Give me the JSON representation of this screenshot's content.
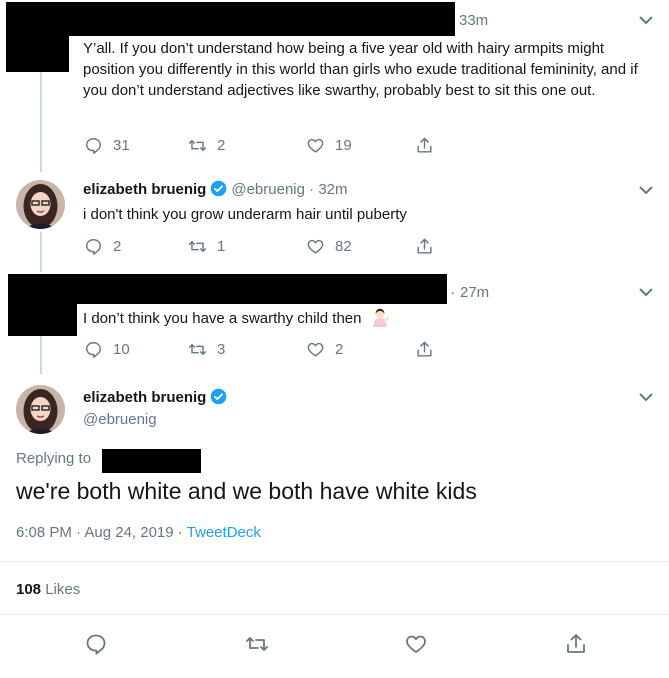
{
  "tweet1": {
    "time": "33m",
    "text": "Y’all. If you don’t understand how being a five year old with hairy armpits might position you differently in this world than girls who exude traditional femininity, and if you don’t understand adjectives like swarthy, probably best to sit this one out.",
    "replies": "31",
    "retweets": "2",
    "likes": "19"
  },
  "tweet2": {
    "name": "elizabeth bruenig",
    "handle": "@ebruenig",
    "time": "32m",
    "text": "i don't think you grow underarm hair until puberty",
    "replies": "2",
    "retweets": "1",
    "likes": "82"
  },
  "tweet3": {
    "time": "27m",
    "text": "I don’t think you have a swarthy child then",
    "emoji": "woman-tipping-hand-emoji",
    "replies": "10",
    "retweets": "3",
    "likes": "2"
  },
  "main": {
    "name": "elizabeth bruenig",
    "handle": "@ebruenig",
    "replying_to": "Replying to",
    "text": "we're both white and we both have white kids",
    "timestamp": "6:08 PM · Aug 24, 2019 · ",
    "source": "TweetDeck",
    "likes_count": "108",
    "likes_label": "Likes"
  },
  "colors": {
    "accent": "#1da1f2",
    "secondary": "#657786",
    "line": "#ccd6dd"
  }
}
